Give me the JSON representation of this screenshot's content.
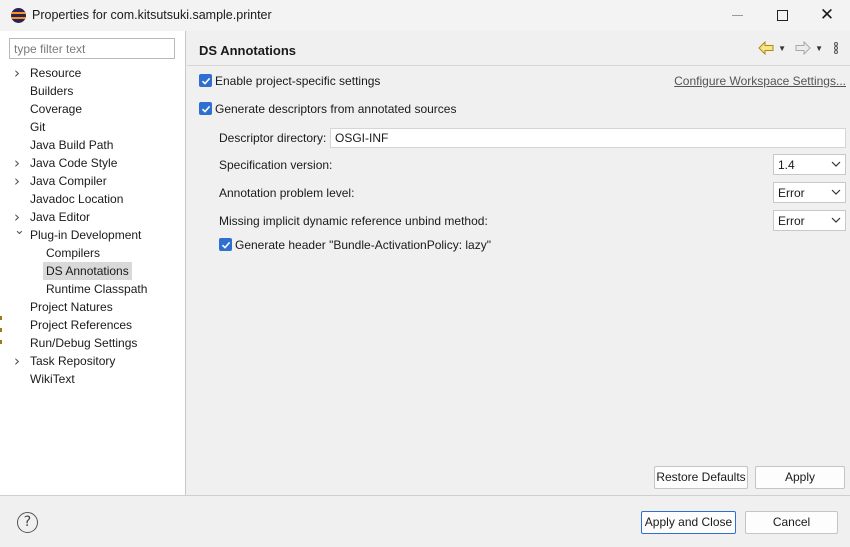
{
  "window": {
    "title": "Properties for com.kitsutsuki.sample.printer",
    "icon": "eclipse-icon"
  },
  "sidebar": {
    "filter_placeholder": "type filter text",
    "items": [
      {
        "label": "Resource",
        "expander": "collapsed"
      },
      {
        "label": "Builders",
        "expander": "none"
      },
      {
        "label": "Coverage",
        "expander": "none"
      },
      {
        "label": "Git",
        "expander": "none"
      },
      {
        "label": "Java Build Path",
        "expander": "none"
      },
      {
        "label": "Java Code Style",
        "expander": "collapsed"
      },
      {
        "label": "Java Compiler",
        "expander": "collapsed"
      },
      {
        "label": "Javadoc Location",
        "expander": "none"
      },
      {
        "label": "Java Editor",
        "expander": "collapsed"
      },
      {
        "label": "Plug-in Development",
        "expander": "expanded"
      },
      {
        "label": "Compilers",
        "expander": "child"
      },
      {
        "label": "DS Annotations",
        "expander": "child-selected"
      },
      {
        "label": "Runtime Classpath",
        "expander": "child"
      },
      {
        "label": "Project Natures",
        "expander": "none"
      },
      {
        "label": "Project References",
        "expander": "none"
      },
      {
        "label": "Run/Debug Settings",
        "expander": "none"
      },
      {
        "label": "Task Repository",
        "expander": "collapsed"
      },
      {
        "label": "WikiText",
        "expander": "none"
      }
    ]
  },
  "page": {
    "title": "DS Annotations",
    "enable_project_settings": {
      "label": "Enable project-specific settings",
      "checked": true
    },
    "configure_link": "Configure Workspace Settings...",
    "generate_descriptors": {
      "label": "Generate descriptors from annotated sources",
      "checked": true
    },
    "descriptor_directory": {
      "label": "Descriptor directory:",
      "value": "OSGI-INF"
    },
    "spec_version": {
      "label": "Specification version:",
      "value": "1.4"
    },
    "problem_level": {
      "label": "Annotation problem level:",
      "value": "Error"
    },
    "unbind_method": {
      "label": "Missing implicit dynamic reference unbind method:",
      "value": "Error"
    },
    "generate_header": {
      "label": "Generate header \"Bundle-ActivationPolicy: lazy\"",
      "checked": true
    },
    "restore_defaults": "Restore Defaults",
    "apply": "Apply"
  },
  "footer": {
    "apply_and_close": "Apply and Close",
    "cancel": "Cancel"
  },
  "colors": {
    "accent": "#2f6fcf",
    "selection": "#d9d9d9"
  }
}
